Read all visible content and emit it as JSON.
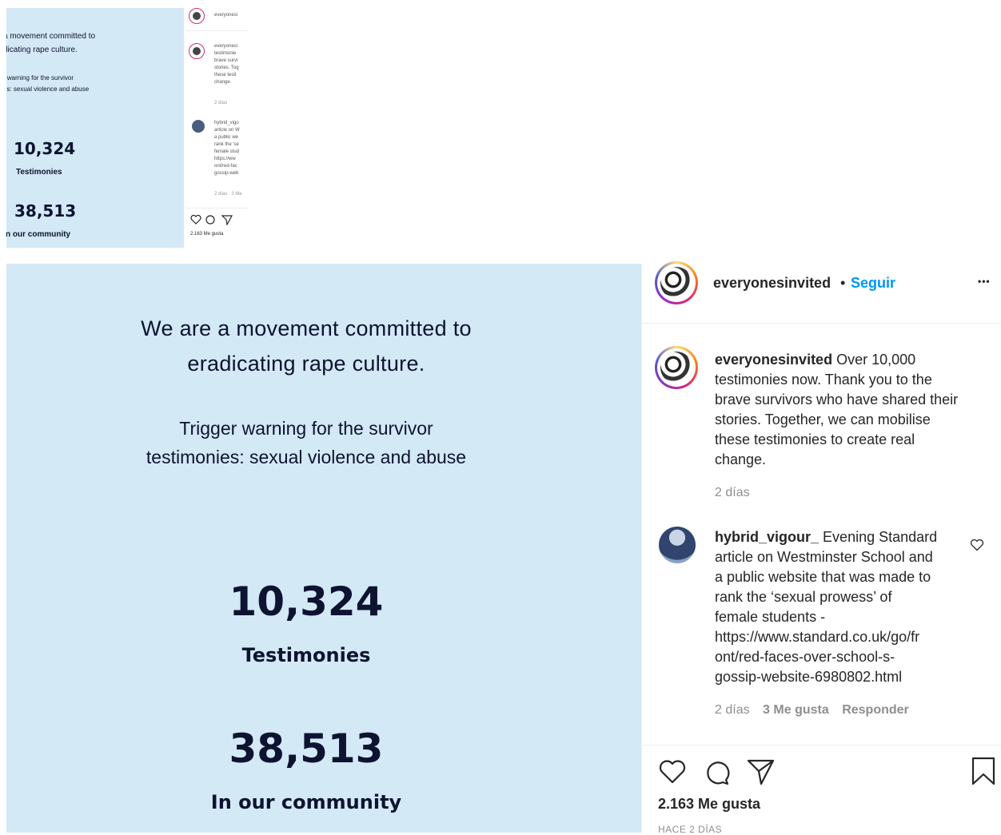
{
  "thumbnail": {
    "mission_line1": "a movement committed to",
    "mission_line2": "dicating rape culture.",
    "warning_line1": "r warning for the survivor",
    "warning_line2": "es: sexual violence and abuse",
    "stat1_value": "10,324",
    "stat1_label": "Testimonies",
    "stat2_value": "38,513",
    "stat2_label": "n our community",
    "side_user": "everyonesi",
    "side_caption": [
      "everyonesi",
      "testimonie",
      "brave survi",
      "stories. Tog",
      "these testi",
      "change."
    ],
    "side_time": "2 días",
    "side_comment": [
      "hybrid_vigo",
      "article on W",
      "a public we",
      "rank the 'se",
      "female stud",
      "https://ww",
      "ont/red-fac",
      "gossip-web"
    ],
    "side_comment_meta": "2 días   3 Me",
    "side_likes": "2.163 Me gusta"
  },
  "photo": {
    "mission_line1": "We are a movement committed to",
    "mission_line2": "eradicating rape culture.",
    "warning_line1": "Trigger warning for the survivor",
    "warning_line2": "testimonies: sexual violence and abuse",
    "stat1_value": "10,324",
    "stat1_label": "Testimonies",
    "stat2_value": "38,513",
    "stat2_label": "In our community"
  },
  "header": {
    "username": "everyonesinvited",
    "separator": "•",
    "follow_label": "Seguir",
    "more_label": "•••"
  },
  "caption": {
    "username": "everyonesinvited",
    "text": "Over 10,000 testimonies now. Thank you to the brave survivors who have shared their stories. Together, we can mobilise these testimonies to create real change.",
    "lines": [
      "testimonies now. Thank you to the",
      "brave survivors who have shared their",
      "stories. Together, we can mobilise",
      "these testimonies to create real",
      "change."
    ],
    "first_line_text": "Over 10,000",
    "time": "2 días"
  },
  "comment": {
    "username": "hybrid_vigour_",
    "first_line_text": "Evening Standard",
    "lines": [
      "article on Westminster School and",
      "a public website that was made to",
      "rank the ‘sexual prowess’ of",
      "female students -",
      "https://www.standard.co.uk/go/fr",
      "ont/red-faces-over-school-s-",
      "gossip-website-6980802.html"
    ],
    "time": "2 días",
    "likes": "3 Me gusta",
    "reply_label": "Responder"
  },
  "actions": {
    "likes_count": "2.163 Me gusta",
    "timestamp": "HACE 2 DÍAS"
  },
  "icons": [
    "heart-icon",
    "comment-icon",
    "share-icon",
    "bookmark-icon",
    "more-icon"
  ]
}
